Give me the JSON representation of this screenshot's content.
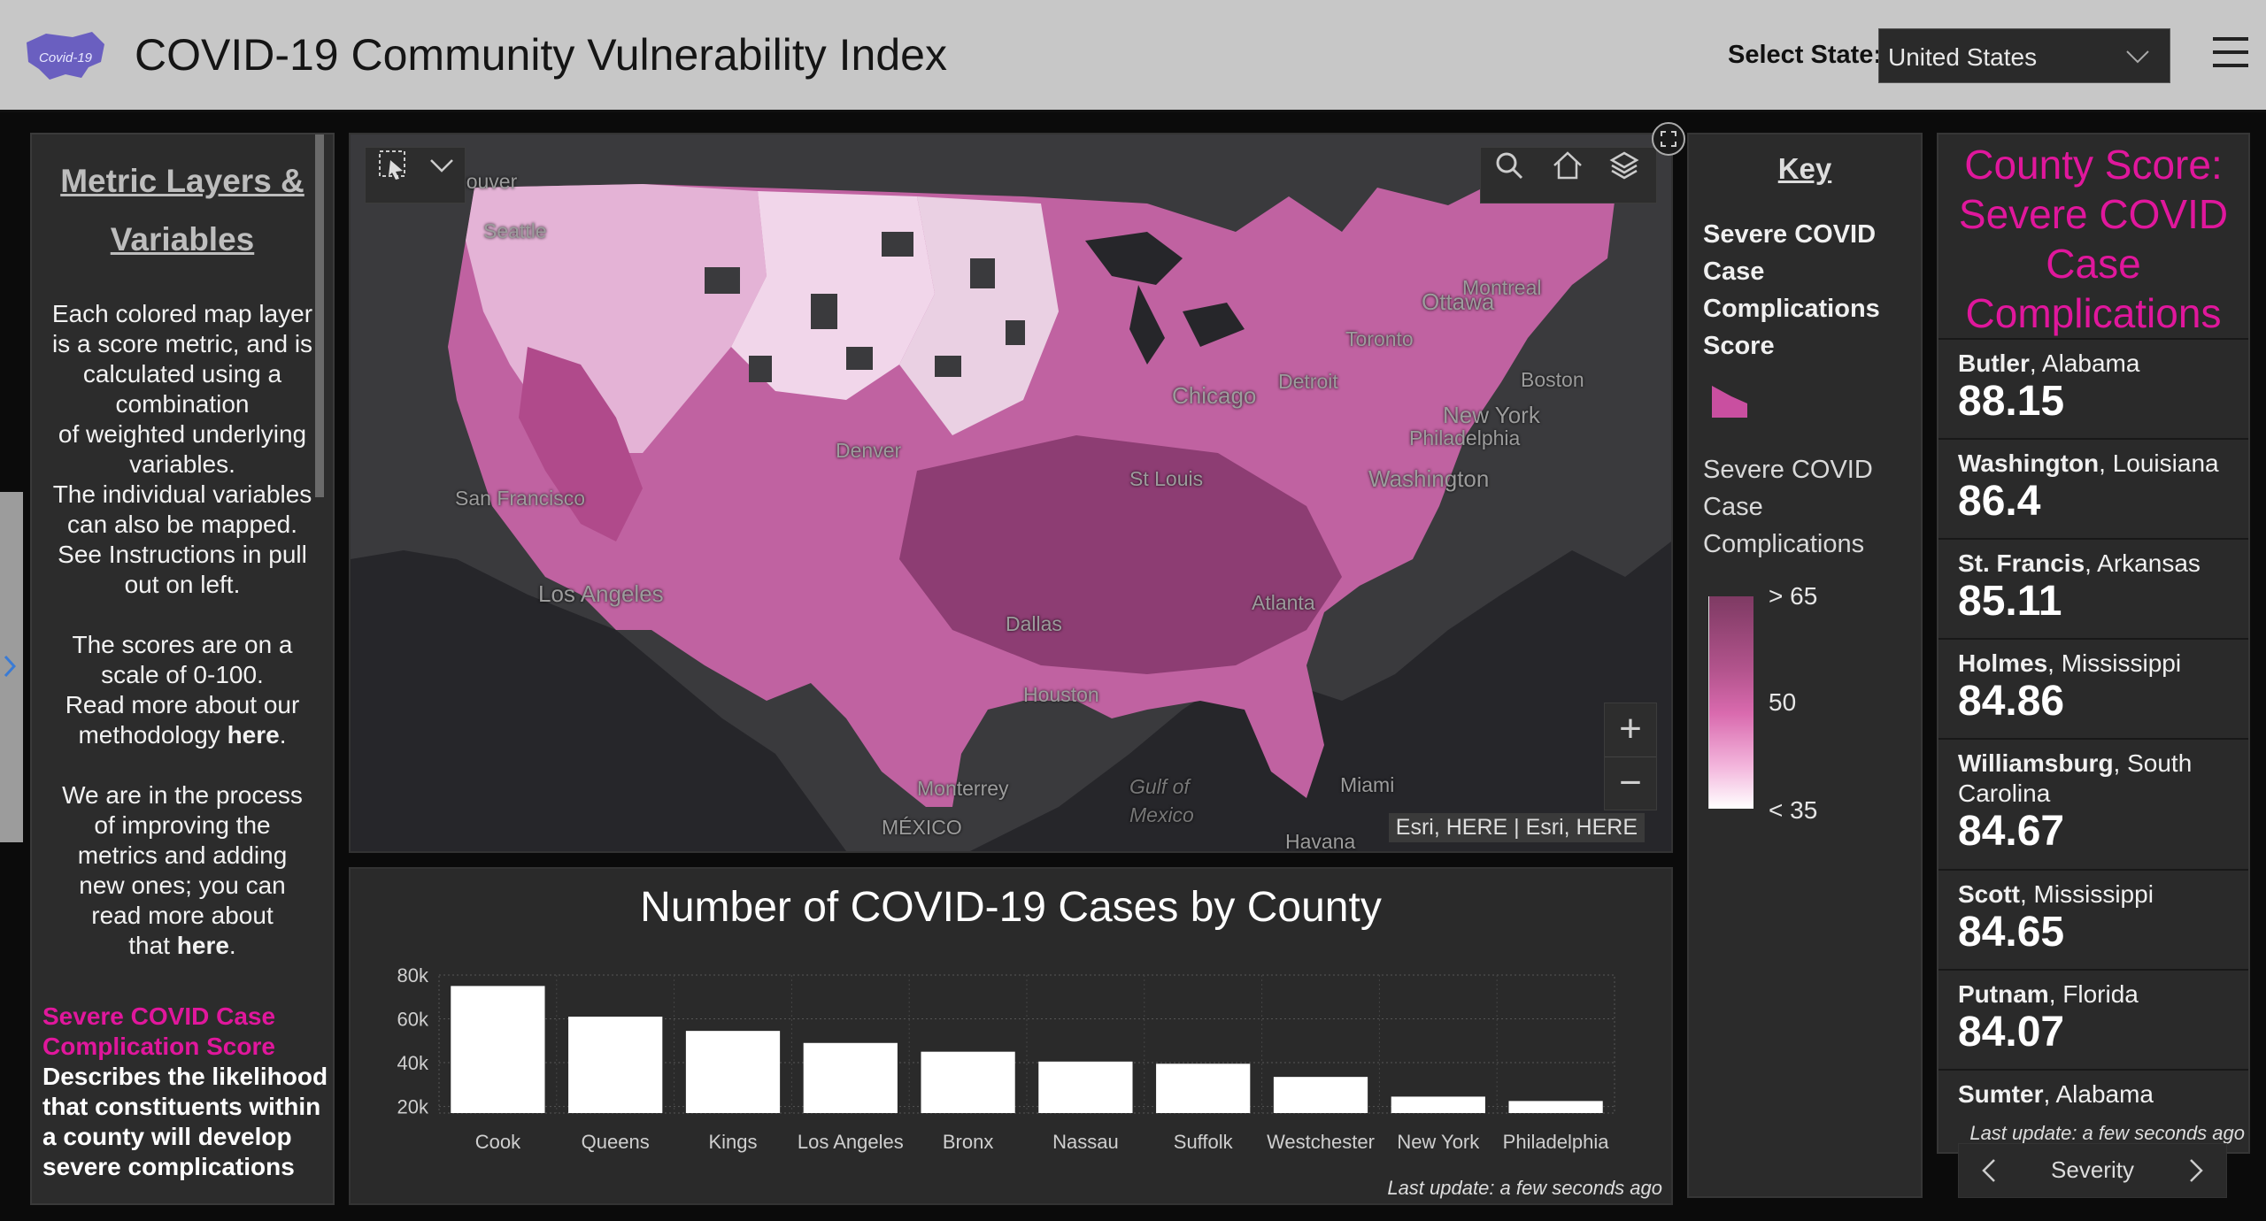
{
  "header": {
    "logo_text": "Covid-19",
    "title": "COVID-19 Community Vulnerability Index",
    "select_label": "Select State:",
    "select_value": "United States"
  },
  "left_panel": {
    "title_line1": "Metric Layers &",
    "title_line2": "Variables",
    "p1_lines": [
      "Each colored map layer",
      "is a score metric, and is",
      "calculated using a",
      "combination",
      "of weighted underlying",
      "variables.",
      "The individual variables",
      "can also be mapped.",
      "See Instructions in pull",
      "out on left."
    ],
    "p2_lines": [
      "The scores are on a",
      "scale of 0-100.",
      "Read more about our"
    ],
    "p2_tail_pre": "methodology ",
    "p2_link": "here",
    "p2_tail_post": ".",
    "p3_lines": [
      "We are in the process",
      "of improving the",
      "metrics and adding",
      "new ones; you can",
      "read more about"
    ],
    "p3_tail_pre": "that ",
    "p3_link": "here",
    "p3_tail_post": ".",
    "metric_name": "Severe COVID Case Complication Score",
    "metric_desc": "Describes the likelihood that constituents within a county will develop severe complications"
  },
  "map": {
    "labels": {
      "vancouver": "Vancouver",
      "seattle": "Seattle",
      "san_francisco": "San Francisco",
      "los_angeles": "Los Angeles",
      "denver": "Denver",
      "dallas": "Dallas",
      "houston": "Houston",
      "monterrey": "Monterrey",
      "mexico": "MÉXICO",
      "gulf": "Gulf of",
      "gulf2": "Mexico",
      "havana": "Havana",
      "miami": "Miami",
      "atlanta": "Atlanta",
      "st_louis": "St Louis",
      "chicago": "Chicago",
      "detroit": "Detroit",
      "toronto": "Toronto",
      "ottawa": "Ottawa",
      "montreal": "Montreal",
      "boston": "Boston",
      "new_york": "New York",
      "philadelphia": "Philadelphia",
      "washington": "Washington"
    },
    "attribution": "Esri, HERE | Esri, HERE",
    "zoom_in": "+",
    "zoom_out": "−"
  },
  "chart_data": {
    "type": "bar",
    "title": "Number of COVID-19 Cases by County",
    "categories": [
      "Cook",
      "Queens",
      "Kings",
      "Los Angeles",
      "Bronx",
      "Nassau",
      "Suffolk",
      "Westchester",
      "New York",
      "Philadelphia"
    ],
    "values": [
      75000,
      61000,
      54500,
      49000,
      45000,
      40500,
      39500,
      33500,
      24500,
      22500
    ],
    "yticks": [
      "80k",
      "60k",
      "40k",
      "20k"
    ],
    "ytick_values": [
      80000,
      60000,
      40000,
      20000
    ],
    "ylim": [
      17000,
      80000
    ],
    "grid": true,
    "bar_color": "#ffffff",
    "footer": "Last update: a few seconds ago"
  },
  "key": {
    "title": "Key",
    "layer": [
      "Severe COVID",
      "Case",
      "Complications",
      "Score"
    ],
    "field": [
      "Severe COVID",
      "Case",
      "Complications"
    ],
    "ramp_labels": [
      "> 65",
      "50",
      "< 35"
    ],
    "swatch_color": "#c94fa0"
  },
  "scores": {
    "title_lines": [
      "County Score:",
      "Severe COVID",
      "Case",
      "Complications"
    ],
    "items": [
      {
        "county": "Butler",
        "state": ", Alabama",
        "score": "88.15"
      },
      {
        "county": "Washington",
        "state": ", Louisiana",
        "score": "86.4"
      },
      {
        "county": "St. Francis",
        "state": ", Arkansas",
        "score": "85.11"
      },
      {
        "county": "Holmes",
        "state": ", Mississippi",
        "score": "84.86"
      },
      {
        "county": "Williamsburg",
        "state": ", South Carolina",
        "score": "84.67"
      },
      {
        "county": "Scott",
        "state": ", Mississippi",
        "score": "84.65"
      },
      {
        "county": "Putnam",
        "state": ", Florida",
        "score": "84.07"
      },
      {
        "county": "Sumter",
        "state": ", Alabama",
        "score": ""
      }
    ],
    "footer": "Last update: a few seconds ago",
    "sort_label": "Severity"
  },
  "colors": {
    "accent_magenta": "#e0179c",
    "header_bg": "#c7c7c7",
    "panel_bg": "#2a2a2a"
  }
}
